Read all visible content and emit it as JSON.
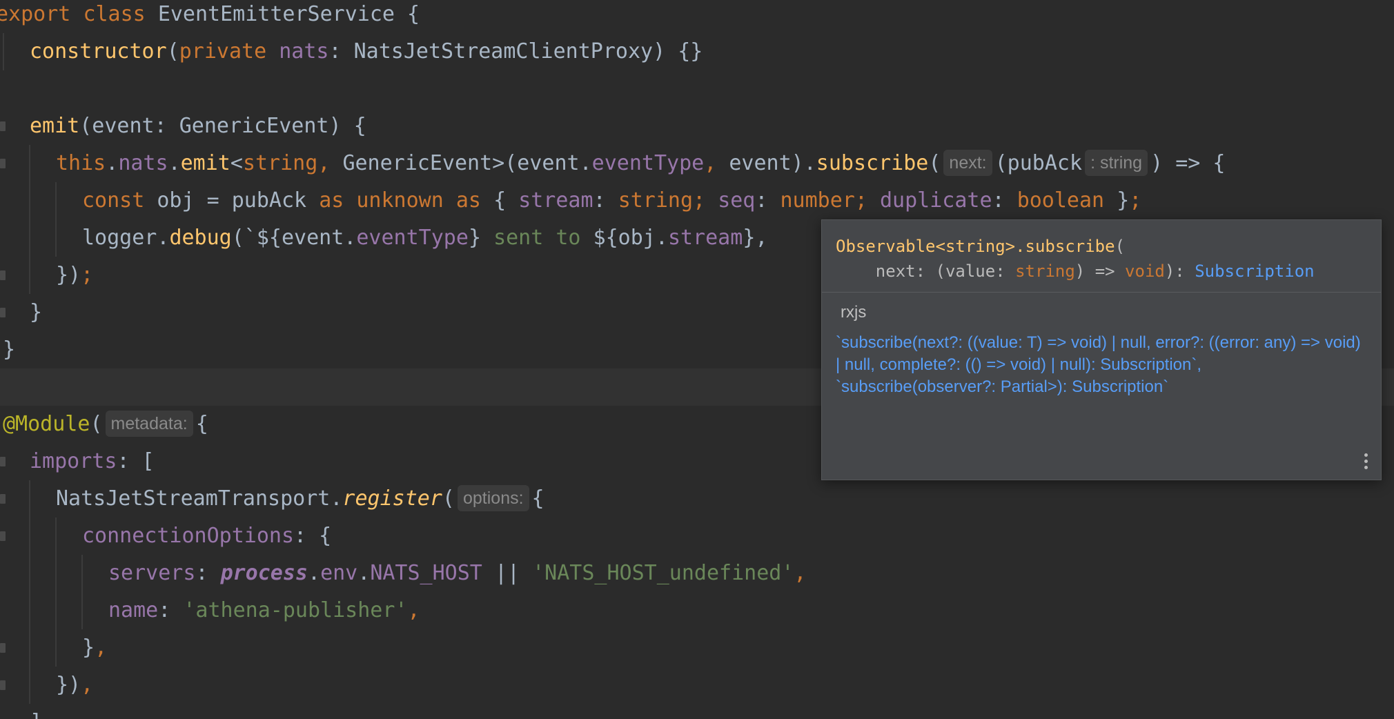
{
  "editor": {
    "lines": [
      {
        "id": "l1",
        "tokens": [
          {
            "t": "export ",
            "c": "kw"
          },
          {
            "t": "class ",
            "c": "kw"
          },
          {
            "t": "EventEmitterService {",
            "c": "plain"
          }
        ]
      },
      {
        "id": "l2",
        "tokens": [
          {
            "t": "constructor",
            "c": "fn"
          },
          {
            "t": "(",
            "c": "plain"
          },
          {
            "t": "private ",
            "c": "kw"
          },
          {
            "t": "nats",
            "c": "pp"
          },
          {
            "t": ": NatsJetStreamClientProxy) {}",
            "c": "plain"
          }
        ]
      },
      {
        "id": "l4",
        "tokens": [
          {
            "t": "emit",
            "c": "fn"
          },
          {
            "t": "(event: GenericEvent) {",
            "c": "plain"
          }
        ]
      },
      {
        "id": "l5",
        "tokens": [
          {
            "t": "this",
            "c": "kw"
          },
          {
            "t": ".",
            "c": "plain"
          },
          {
            "t": "nats",
            "c": "pp"
          },
          {
            "t": ".",
            "c": "plain"
          },
          {
            "t": "emit",
            "c": "fn"
          },
          {
            "t": "<",
            "c": "plain"
          },
          {
            "t": "string",
            "c": "kw"
          },
          {
            "t": ", ",
            "c": "kw"
          },
          {
            "t": "GenericEvent>(event.",
            "c": "plain"
          },
          {
            "t": "eventType",
            "c": "pp"
          },
          {
            "t": ", ",
            "c": "kw"
          },
          {
            "t": "event).",
            "c": "plain"
          },
          {
            "t": "subscribe",
            "c": "fn"
          },
          {
            "t": "(",
            "c": "plain"
          },
          {
            "hint": "next:"
          },
          {
            "t": "(pubAck",
            "c": "plain"
          },
          {
            "hint": ": string"
          },
          {
            "t": ") => {",
            "c": "plain"
          }
        ]
      },
      {
        "id": "l6",
        "tokens": [
          {
            "t": "const ",
            "c": "kw"
          },
          {
            "t": "obj = pubAck ",
            "c": "plain"
          },
          {
            "t": "as ",
            "c": "kw"
          },
          {
            "t": "unknown ",
            "c": "kw"
          },
          {
            "t": "as ",
            "c": "kw"
          },
          {
            "t": "{ ",
            "c": "plain"
          },
          {
            "t": "stream",
            "c": "pp"
          },
          {
            "t": ": ",
            "c": "plain"
          },
          {
            "t": "string",
            "c": "kw"
          },
          {
            "t": "; ",
            "c": "kw"
          },
          {
            "t": "seq",
            "c": "pp"
          },
          {
            "t": ": ",
            "c": "plain"
          },
          {
            "t": "number",
            "c": "kw"
          },
          {
            "t": "; ",
            "c": "kw"
          },
          {
            "t": "duplicate",
            "c": "pp"
          },
          {
            "t": ": ",
            "c": "plain"
          },
          {
            "t": "boolean ",
            "c": "kw"
          },
          {
            "t": "}",
            "c": "plain"
          },
          {
            "t": ";",
            "c": "kw"
          }
        ]
      },
      {
        "id": "l7",
        "tokens": [
          {
            "t": "logger.",
            "c": "plain"
          },
          {
            "t": "debug",
            "c": "fn"
          },
          {
            "t": "(`${event.",
            "c": "plain"
          },
          {
            "t": "eventType",
            "c": "pp"
          },
          {
            "t": "} ",
            "c": "plain"
          },
          {
            "t": "sent to ",
            "c": "str"
          },
          {
            "t": "${obj.",
            "c": "plain"
          },
          {
            "t": "stream",
            "c": "pp"
          },
          {
            "t": "},",
            "c": "plain"
          }
        ]
      },
      {
        "id": "l8",
        "tokens": [
          {
            "t": "})",
            "c": "plain"
          },
          {
            "t": ";",
            "c": "kw"
          }
        ]
      },
      {
        "id": "l9",
        "tokens": [
          {
            "t": "}",
            "c": "plain"
          }
        ]
      },
      {
        "id": "l10",
        "tokens": [
          {
            "t": "}",
            "c": "plain"
          }
        ]
      },
      {
        "id": "l12",
        "tokens": [
          {
            "t": "@Module",
            "c": "ann"
          },
          {
            "t": "(",
            "c": "plain"
          },
          {
            "hint": "metadata:"
          },
          {
            "t": "{",
            "c": "plain"
          }
        ]
      },
      {
        "id": "l13",
        "tokens": [
          {
            "t": "imports",
            "c": "pp"
          },
          {
            "t": ": [",
            "c": "plain"
          }
        ]
      },
      {
        "id": "l14",
        "tokens": [
          {
            "t": "NatsJetStreamTransport.",
            "c": "plain"
          },
          {
            "t": "register",
            "c": "fn it"
          },
          {
            "t": "(",
            "c": "plain"
          },
          {
            "hint": "options:"
          },
          {
            "t": "{",
            "c": "plain"
          }
        ]
      },
      {
        "id": "l15",
        "tokens": [
          {
            "t": "connectionOptions",
            "c": "pp"
          },
          {
            "t": ": {",
            "c": "plain"
          }
        ]
      },
      {
        "id": "l16",
        "tokens": [
          {
            "t": "servers",
            "c": "pp"
          },
          {
            "t": ": ",
            "c": "plain"
          },
          {
            "t": "process",
            "c": "bi"
          },
          {
            "t": ".",
            "c": "plain"
          },
          {
            "t": "env",
            "c": "pp"
          },
          {
            "t": ".",
            "c": "plain"
          },
          {
            "t": "NATS_HOST ",
            "c": "pp"
          },
          {
            "t": "|| ",
            "c": "plain"
          },
          {
            "t": "'NATS_HOST_undefined'",
            "c": "str"
          },
          {
            "t": ",",
            "c": "kw"
          }
        ]
      },
      {
        "id": "l17",
        "tokens": [
          {
            "t": "name",
            "c": "pp"
          },
          {
            "t": ": ",
            "c": "plain"
          },
          {
            "t": "'athena-publisher'",
            "c": "str"
          },
          {
            "t": ",",
            "c": "kw"
          }
        ]
      },
      {
        "id": "l18",
        "tokens": [
          {
            "t": "}",
            "c": "plain"
          },
          {
            "t": ",",
            "c": "kw"
          }
        ]
      },
      {
        "id": "l19",
        "tokens": [
          {
            "t": "})",
            "c": "plain"
          },
          {
            "t": ",",
            "c": "kw"
          }
        ]
      },
      {
        "id": "l20",
        "tokens": [
          {
            "t": "]",
            "c": "plain"
          }
        ]
      }
    ]
  },
  "popup": {
    "signature_line1_class": "Observable<string>.subscribe",
    "signature_line1_paren": "(",
    "signature_line2_prefix": "    next: (value: ",
    "signature_line2_type": "string",
    "signature_line2_arrow": ") => ",
    "signature_line2_void": "void",
    "signature_line2_colon": "): ",
    "signature_line2_return": "Subscription",
    "library": "rxjs",
    "doc_line1": "`subscribe(next?: ((value: T) => void) | null, error?: ((error: any) => void) | null, complete?: (() => void) | null): Subscription`,",
    "doc_line2": "`subscribe(observer?: Partial>): Subscription`"
  }
}
